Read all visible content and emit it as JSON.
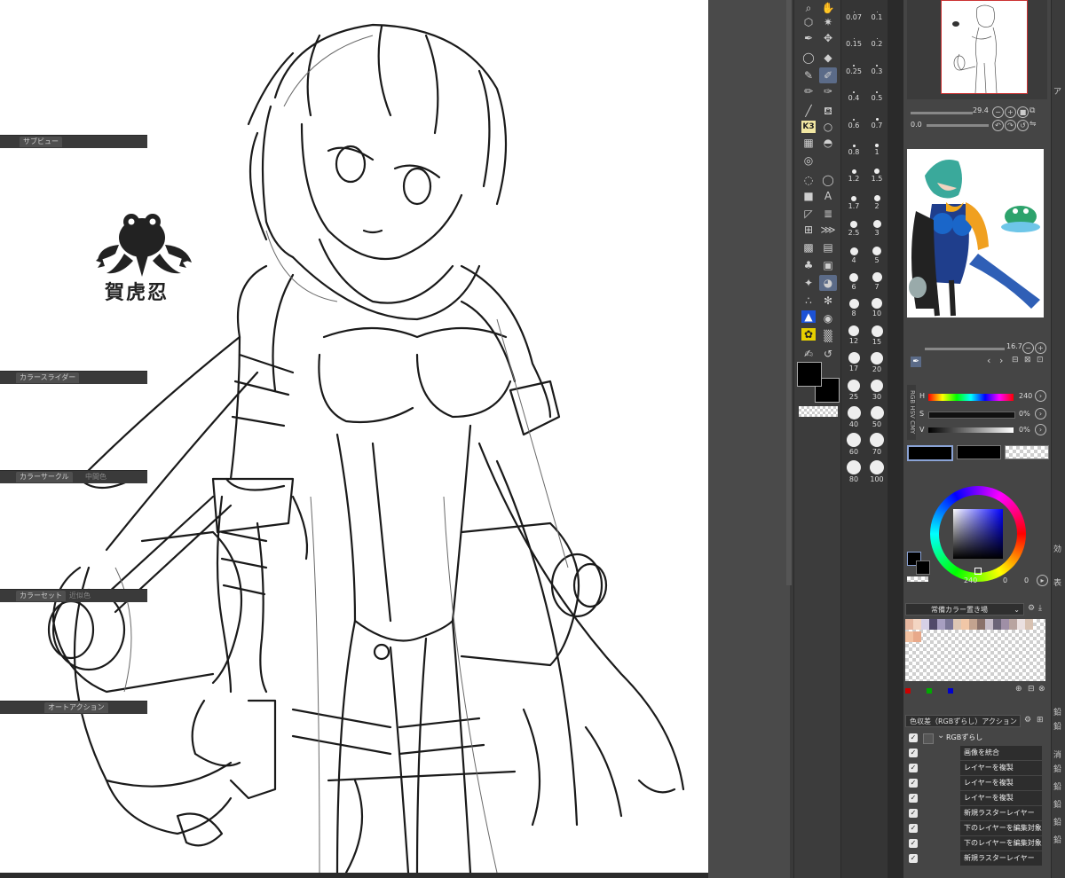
{
  "brush_sizes": [
    "0.07",
    "0.1",
    "0.15",
    "0.2",
    "0.25",
    "0.3",
    "0.4",
    "0.5",
    "0.6",
    "0.7",
    "0.8",
    "1",
    "1.2",
    "1.5",
    "1.7",
    "2",
    "2.5",
    "3",
    "4",
    "5",
    "6",
    "7",
    "8",
    "10",
    "12",
    "15",
    "17",
    "20",
    "25",
    "30",
    "40",
    "50",
    "60",
    "70",
    "80",
    "100"
  ],
  "navigator": {
    "zoom": "29.4",
    "rotate": "0.0"
  },
  "subview": {
    "tab": "サブビュー",
    "zoom": "16.7"
  },
  "color_slider": {
    "tab": "カラースライダー",
    "h_label": "H",
    "s_label": "S",
    "v_label": "V",
    "h_value": "240",
    "s_value": "0%",
    "v_value": "0%",
    "mode_rgb": "RGB",
    "mode_hsv": "HSV",
    "mode_cmyk": "CMY"
  },
  "color_circle": {
    "tab": "カラーサークル",
    "tab2": "中間色",
    "h": "240",
    "s": "0",
    "v": "0"
  },
  "color_set": {
    "tab": "カラーセット",
    "tab2": "近似色",
    "set_name": "常備カラー置き場"
  },
  "auto_action": {
    "tab": "オートアクション",
    "set_name": "色収差（RGBずらし）アクション",
    "root": "RGBずらし",
    "items": [
      "画像を統合",
      "レイヤーを複製",
      "レイヤーを複製",
      "レイヤーを複製",
      "新規ラスターレイヤー",
      "下のレイヤーを編集対象",
      "下のレイヤーを編集対象",
      "新規ラスターレイヤー"
    ]
  },
  "logo_text": "賀虎忍",
  "far_right": [
    "ア",
    "効",
    "表",
    "鉛",
    "鉛",
    "消",
    "鉛",
    "鉛",
    "鉛",
    "鉛",
    "鉛"
  ],
  "colors": {
    "hue_accent": "#1c52d6",
    "selected_tool": "#5b6b88"
  }
}
